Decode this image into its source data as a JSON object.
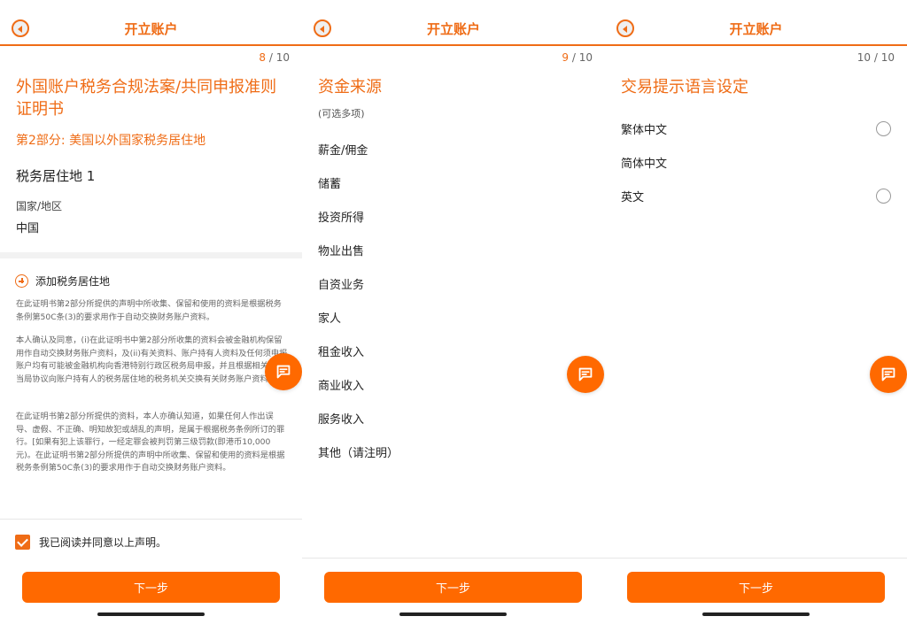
{
  "app_title": "开立账户",
  "screens": [
    {
      "page_current": "8",
      "page_total": "/ 10",
      "progress_pct": 80,
      "heading": "外国账户税务合规法案/共同申报准则证明书",
      "subheading": "第2部分: 美国以外国家税务居住地",
      "residence_title": "税务居住地 1",
      "country_label": "国家/地区",
      "country_value": "中国",
      "add_residence": "添加税务居住地",
      "para1": "在此证明书第2部分所提供的声明中所收集、保留和使用的资料是根据税务条例第50C条(3)的要求用作于自动交换财务账户资料。",
      "para2": "本人确认及同意，(i)在此证明书中第2部分所收集的资料会被金融机构保留用作自动交换财务账户资料，及(ii)有关资料、账户持有人资料及任何须申报账户均有可能被金融机构向香港特别行政区税务局申报，并且根据相关主管当局协议向账户持有人的税务居住地的税务机关交换有关财务账户资料。",
      "para3": "在此证明书第2部分所提供的资料，本人亦确认知道，如果任何人作出误导、虚假、不正确、明知故犯或胡乱的声明，是属于根据税务条例所订的罪行。[如果有犯上该罪行，一经定罪会被判罚第三级罚款(即港币10,000元)。在此证明书第2部分所提供的声明中所收集、保留和使用的资料是根据税务条例第50C条(3)的要求用作于自动交换财务账户资料。",
      "agree_text": "我已阅读并同意以上声明。",
      "next_label": "下一步"
    },
    {
      "page_current": "9",
      "page_total": "/ 10",
      "progress_pct": 90,
      "heading": "资金来源",
      "subheading": "(可选多项)",
      "items": [
        "薪金/佣金",
        "储蓄",
        "投资所得",
        "物业出售",
        "自资业务",
        "家人",
        "租金收入",
        "商业收入",
        "服务收入",
        "其他（请注明）"
      ],
      "next_label": "下一步"
    },
    {
      "page_current": "10",
      "page_total": "/ 10",
      "progress_pct": 100,
      "heading": "交易提示语言设定",
      "options": [
        {
          "label": "繁体中文",
          "selected": false
        },
        {
          "label": "简体中文",
          "selected": true
        },
        {
          "label": "英文",
          "selected": false
        }
      ],
      "next_label": "下一步"
    }
  ],
  "colors": {
    "accent": "#ef6c16",
    "button": "#ff6900"
  },
  "icons": {
    "back": "back-circle-icon",
    "chat": "chat-bubble-icon",
    "add": "plus-circle-icon",
    "check": "checkbox-checked-icon"
  }
}
